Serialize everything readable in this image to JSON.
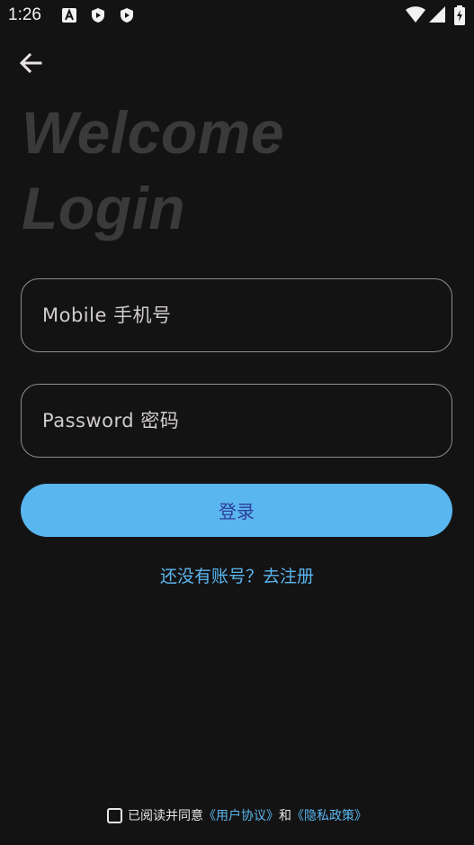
{
  "status_bar": {
    "time": "1:26"
  },
  "header": {
    "back_icon": "arrow-left-icon"
  },
  "welcome": {
    "line1": "Welcome",
    "line2": "Login"
  },
  "form": {
    "mobile_placeholder": "Mobile 手机号",
    "password_placeholder": "Password 密码",
    "login_label": "登录",
    "register_link": "还没有账号？去注册"
  },
  "agreement": {
    "prefix": "已阅读并同意",
    "user_agreement": "《用户协议》",
    "and": "和",
    "privacy_policy": "《隐私政策》"
  },
  "colors": {
    "accent": "#5ab6ef",
    "background": "#141313",
    "button_text": "#2e3d95"
  }
}
